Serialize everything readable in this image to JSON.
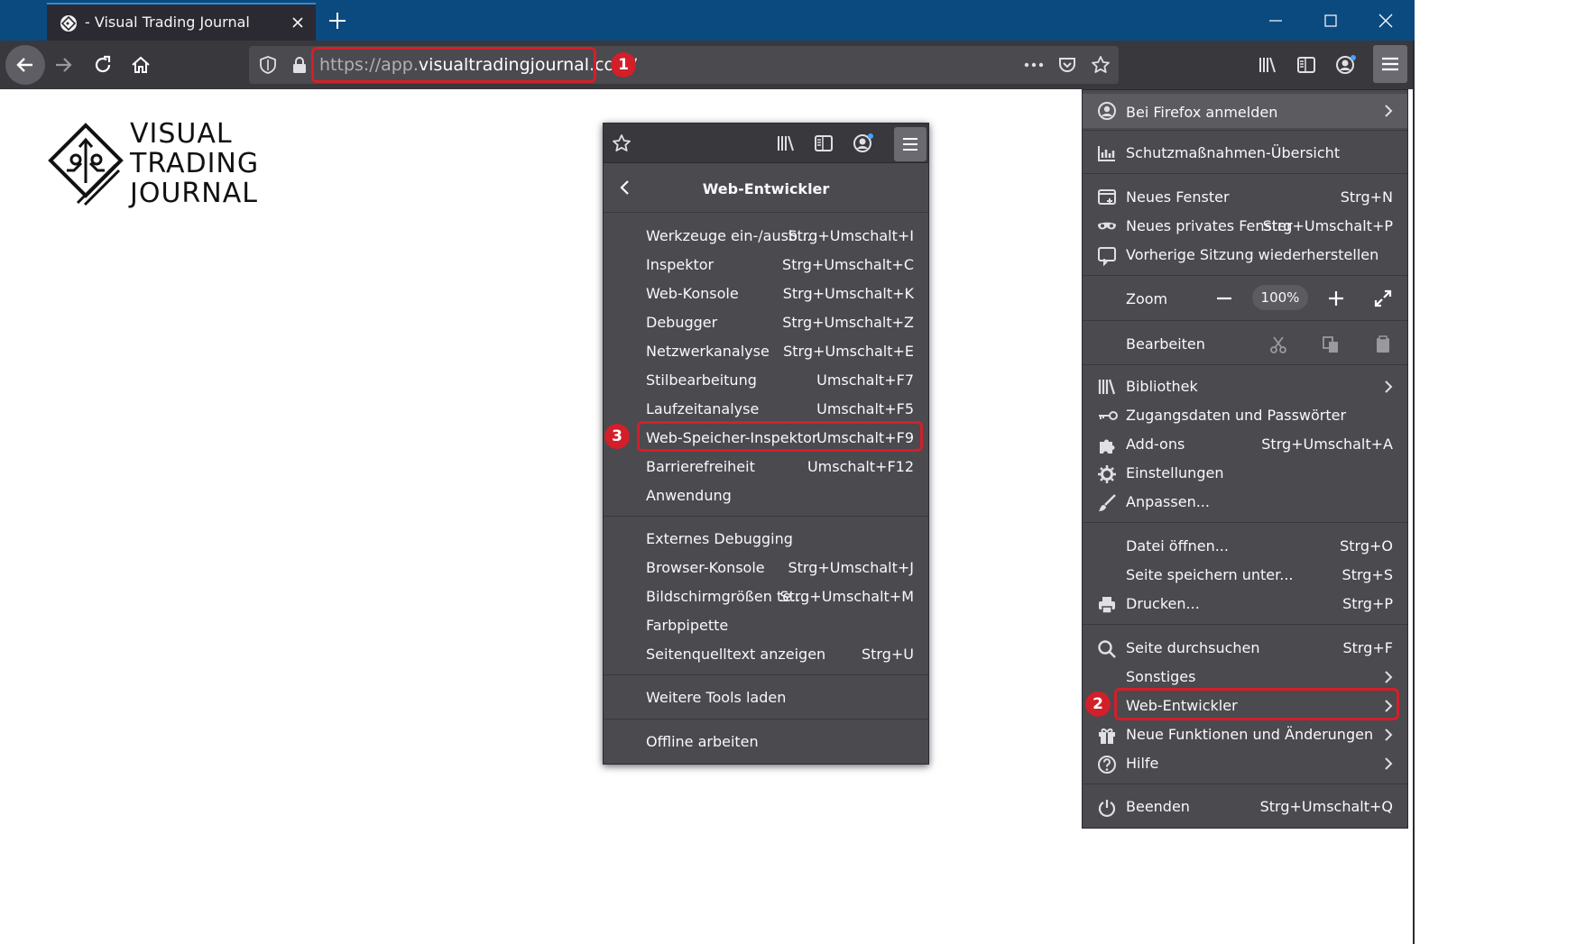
{
  "browser": {
    "tab_title": "- Visual Trading Journal",
    "url_scheme_host": "https://app.",
    "url_domain": "visualtradingjournal.com/",
    "url_dim_tail": "",
    "accent_color": "#0b4a7f",
    "annotation_color": "#d31f2a"
  },
  "annotations": {
    "badge_1": "1",
    "badge_2": "2",
    "badge_3": "3"
  },
  "logo": {
    "line1": "VISUAL",
    "line2": "TRADING",
    "line3": "JOURNAL"
  },
  "dev_panel": {
    "title": "Web-Entwickler",
    "group1": [
      {
        "label": "Werkzeuge ein-/ausb...",
        "shortcut": "Strg+Umschalt+I"
      },
      {
        "label": "Inspektor",
        "shortcut": "Strg+Umschalt+C"
      },
      {
        "label": "Web-Konsole",
        "shortcut": "Strg+Umschalt+K"
      },
      {
        "label": "Debugger",
        "shortcut": "Strg+Umschalt+Z"
      },
      {
        "label": "Netzwerkanalyse",
        "shortcut": "Strg+Umschalt+E"
      },
      {
        "label": "Stilbearbeitung",
        "shortcut": "Umschalt+F7"
      },
      {
        "label": "Laufzeitanalyse",
        "shortcut": "Umschalt+F5"
      },
      {
        "label": "Web-Speicher-Inspektor",
        "shortcut": "Umschalt+F9"
      },
      {
        "label": "Barrierefreiheit",
        "shortcut": "Umschalt+F12"
      },
      {
        "label": "Anwendung",
        "shortcut": ""
      }
    ],
    "group2": [
      {
        "label": "Externes Debugging",
        "shortcut": ""
      },
      {
        "label": "Browser-Konsole",
        "shortcut": "Strg+Umschalt+J"
      },
      {
        "label": "Bildschirmgrößen te...",
        "shortcut": "Strg+Umschalt+M"
      },
      {
        "label": "Farbpipette",
        "shortcut": ""
      },
      {
        "label": "Seitenquelltext anzeigen",
        "shortcut": "Strg+U"
      }
    ],
    "more_tools": "Weitere Tools laden",
    "offline": "Offline arbeiten"
  },
  "main_menu": {
    "signin": "Bei Firefox anmelden",
    "protections": "Schutzmaßnahmen-Übersicht",
    "new_window": {
      "label": "Neues Fenster",
      "shortcut": "Strg+N"
    },
    "new_private": {
      "label": "Neues privates Fenster",
      "shortcut": "Strg+Umschalt+P"
    },
    "restore": {
      "label": "Vorherige Sitzung wiederherstellen",
      "shortcut": ""
    },
    "zoom_label": "Zoom",
    "zoom_value": "100%",
    "edit_label": "Bearbeiten",
    "library": "Bibliothek",
    "logins": "Zugangsdaten und Passwörter",
    "addons": {
      "label": "Add-ons",
      "shortcut": "Strg+Umschalt+A"
    },
    "settings": "Einstellungen",
    "customize": "Anpassen...",
    "open_file": {
      "label": "Datei öffnen...",
      "shortcut": "Strg+O"
    },
    "save_page": {
      "label": "Seite speichern unter...",
      "shortcut": "Strg+S"
    },
    "print": {
      "label": "Drucken...",
      "shortcut": "Strg+P"
    },
    "find": {
      "label": "Seite durchsuchen",
      "shortcut": "Strg+F"
    },
    "more": "Sonstiges",
    "web_dev": "Web-Entwickler",
    "whats_new": "Neue Funktionen und Änderungen",
    "help": "Hilfe",
    "quit": {
      "label": "Beenden",
      "shortcut": "Strg+Umschalt+Q"
    }
  }
}
